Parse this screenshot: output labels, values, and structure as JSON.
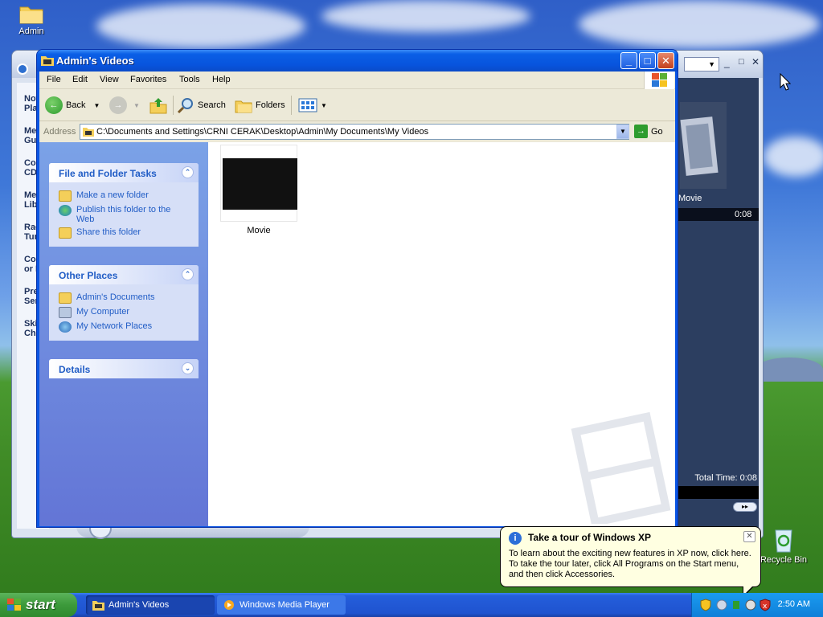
{
  "desktop": {
    "icons": [
      {
        "label": "Admin"
      },
      {
        "label": "Recycle Bin"
      }
    ]
  },
  "wmp": {
    "nav": [
      "Now Play",
      "Med Guid",
      "Cop CD",
      "Med Libr",
      "Rad Tun",
      "Cop or D",
      "Prem Serv",
      "Skin Cho"
    ],
    "now_playing_title": "Movie",
    "elapsed": "0:08",
    "total_time": "Total Time: 0:08"
  },
  "explorer": {
    "title": "Admin's Videos",
    "menu": [
      "File",
      "Edit",
      "View",
      "Favorites",
      "Tools",
      "Help"
    ],
    "toolbar": {
      "back": "Back",
      "search": "Search",
      "folders": "Folders"
    },
    "address": {
      "label": "Address",
      "value": "C:\\Documents and Settings\\CRNI CERAK\\Desktop\\Admin\\My Documents\\My Videos",
      "go": "Go"
    },
    "tasks": {
      "file_folder": {
        "title": "File and Folder Tasks",
        "items": [
          "Make a new folder",
          "Publish this folder to the Web",
          "Share this folder"
        ]
      },
      "other_places": {
        "title": "Other Places",
        "items": [
          "Admin's Documents",
          "My Computer",
          "My Network Places"
        ]
      },
      "details": {
        "title": "Details"
      }
    },
    "files": [
      {
        "name": "Movie"
      }
    ]
  },
  "balloon": {
    "title": "Take a tour of Windows XP",
    "text": "To learn about the exciting new features in XP now, click here. To take the tour later, click All Programs on the Start menu, and then click Accessories."
  },
  "taskbar": {
    "start": "start",
    "tasks": [
      "Admin's Videos",
      "Windows Media Player"
    ],
    "clock": "2:50 AM"
  },
  "colors": {
    "title_blue": "#0a55e3",
    "task_link": "#215dc6",
    "start_green": "#3c9a3b"
  }
}
